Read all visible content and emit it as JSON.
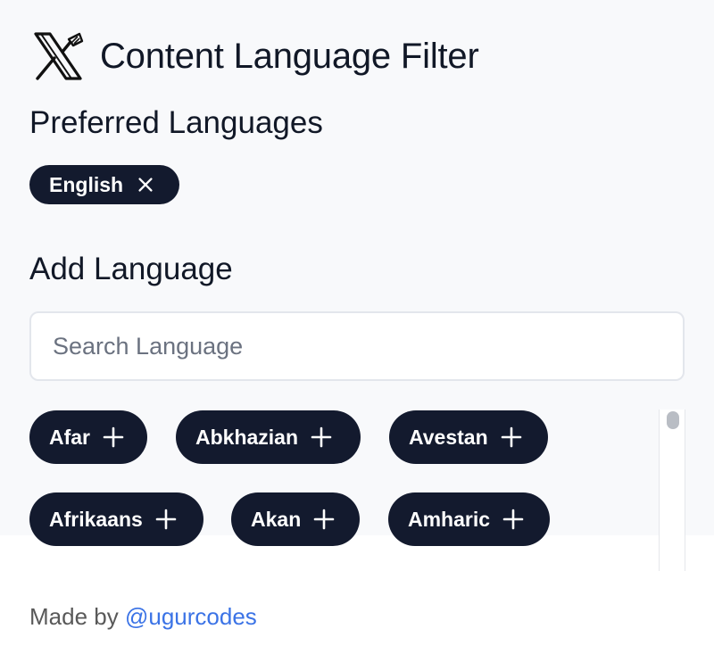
{
  "app": {
    "title": "Content Language Filter",
    "logo_icon": "x-logo-with-flag-icon"
  },
  "preferred": {
    "heading": "Preferred Languages",
    "languages": [
      {
        "label": "English",
        "icon": "close-icon"
      }
    ]
  },
  "add": {
    "heading": "Add Language",
    "search_placeholder": "Search Language",
    "search_value": "",
    "languages": [
      {
        "label": "Afar",
        "icon": "plus-icon"
      },
      {
        "label": "Abkhazian",
        "icon": "plus-icon"
      },
      {
        "label": "Avestan",
        "icon": "plus-icon"
      },
      {
        "label": "Afrikaans",
        "icon": "plus-icon"
      },
      {
        "label": "Akan",
        "icon": "plus-icon"
      },
      {
        "label": "Amharic",
        "icon": "plus-icon"
      }
    ]
  },
  "footer": {
    "prefix": "Made by",
    "link_text": "@ugurcodes"
  },
  "colors": {
    "chip_bg": "#131a2e",
    "panel_bg": "#f8f9fb",
    "link": "#3b73e6"
  }
}
